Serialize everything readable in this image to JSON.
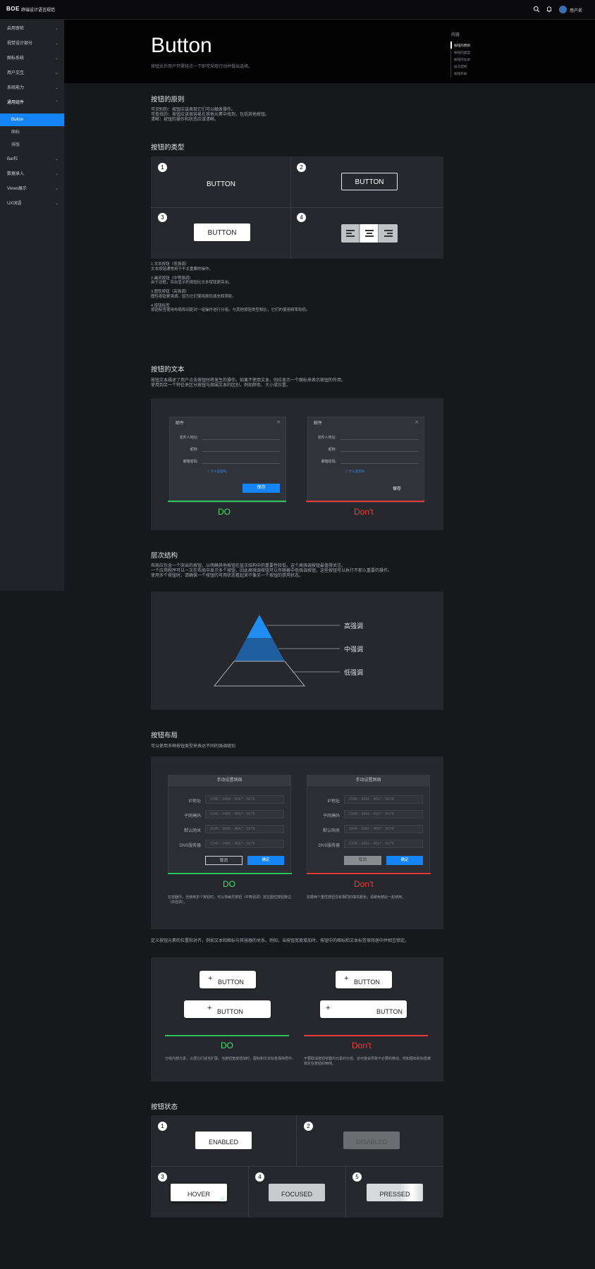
{
  "topbar": {
    "logo": "BOE",
    "app_title": "终端设计语言规范",
    "user": "用户名",
    "search_icon": "search-icon",
    "bell_icon": "bell-icon",
    "avatar_icon": "globe-avatar-icon"
  },
  "sidebar": {
    "items": [
      {
        "label": "启用审检"
      },
      {
        "label": "视觉设计部分"
      },
      {
        "label": "图标系统"
      },
      {
        "label": "用户交互"
      },
      {
        "label": "系统能力"
      },
      {
        "label": "通用组件"
      },
      {
        "label": "Bar栏"
      },
      {
        "label": "数据录入"
      },
      {
        "label": "Views展示"
      },
      {
        "label": "UX词语"
      }
    ],
    "sub_items": [
      {
        "label": "Button"
      },
      {
        "label": "图标"
      },
      {
        "label": "排版"
      }
    ]
  },
  "header": {
    "title": "Button",
    "description": "按钮允许用户只需轻点一下即可采取行动并做出选择。"
  },
  "toc": {
    "title": "内容",
    "items": [
      "按钮的原则",
      "按钮的类型",
      "按钮的文本",
      "层次结构",
      "按钮布局"
    ]
  },
  "principles": {
    "title": "按钮的原则",
    "text": "可识别的：按钮应该表现它们可以触发操作。\n可查找的：按钮应该很容易在其他元素中找到，包括其他按钮。\n清晰：按钮的操作和状态应该清晰。"
  },
  "types": {
    "title": "按钮的类型",
    "numbers": [
      "1",
      "2",
      "3",
      "4"
    ],
    "button_label": "BUTTON",
    "desc": "1.文本按钮（低强调）\n文本按钮通常用于不太重要的操作。\n\n2.幽灵按钮（中等强调）\n由于边框，突出显示的按钮比文本按钮更突出。\n\n3.图性按钮（高强调）\n图性按钮更强调，因为它们使用颜色填充和阴影。\n\n4.按钮标签\n按钮标签使用布局和间距对一组操作进行分组。与其他按钮类型相比，它们的使用频率较低。"
  },
  "text_section": {
    "title": "按钮的文本",
    "desc": "按钮文本描述了用户点击按钮时将发生的操作。如果不使用文本，则应显示一个图标来表示按钮的作用。\n使用到另一个特征来区分按钮与周围文本的区别，例如颜色、大小或位置。",
    "dialog_title": "邮件",
    "labels": [
      "发件人地址:",
      "昵称:",
      "邮箱密码:"
    ],
    "link": "什么是密码",
    "save": "保存",
    "do": "DO",
    "dont": "Don't"
  },
  "hierarchy": {
    "title": "层次结构",
    "desc": "布局应包含一个突出的按钮，以明确其他按钮在层次结构中的重要性较低。这个高强调按钮最值得关注。\n一个应用程序可以一次在布局中显示多个按钮，因此高强调按钮可以伴随着中低强调按钮，这些按钮可以执行不那么重要的操作。\n使用多个按钮时，请确保一个按钮的可用状态看起来不像另一个按钮的禁用状态。",
    "levels": [
      "高强调",
      "中强调",
      "低强调"
    ],
    "colors": {
      "high": "#1f8df2",
      "mid": "#1e5d9e"
    }
  },
  "layout": {
    "title": "按钮布局",
    "desc": "可以使用多种按钮类型来表达不同的强调级别",
    "dialog_title": "手动设置网络",
    "labels": [
      "IP地址",
      "子网掩码",
      "默认网关",
      "DNS服务器"
    ],
    "placeholder": "2345 - 3456 - 4567 - 5678",
    "cancel": "取消",
    "ok": "确定",
    "do": "DO",
    "dont": "Don't",
    "note_do": "在容器中，当使用多个按钮时，可以将幽灵按钮（中等强调）放在图性按钮旁边（高强调）。",
    "note_dont": "如果两个重性按钮没有相同的填充颜色，请避免彼此一起使用。"
  },
  "alignment": {
    "desc": "定义按钮元素的位置和对齐，例如文本和图标与其容器的关系。例如，当按钮宽度增加时，按钮中的图标和文本标签保持居中并相互锁定。",
    "button_label": "BUTTON",
    "do": "DO",
    "dont": "Don't",
    "note_do": "分组内部元素，以便它们适当扩展。当按钮宽度增加时，图标和文本标签保持居中。",
    "note_dont": "不要取消按钮容器内元素的分组。这可能会导致不必要的移动，例如图标和标签被锁定在按钮的两侧。"
  },
  "states": {
    "title": "按钮状态",
    "numbers": [
      "1",
      "2",
      "3",
      "4",
      "5"
    ],
    "labels": [
      "ENABLED",
      "DISABLED",
      "HOVER",
      "FOCUSED",
      "PRESSED"
    ]
  }
}
